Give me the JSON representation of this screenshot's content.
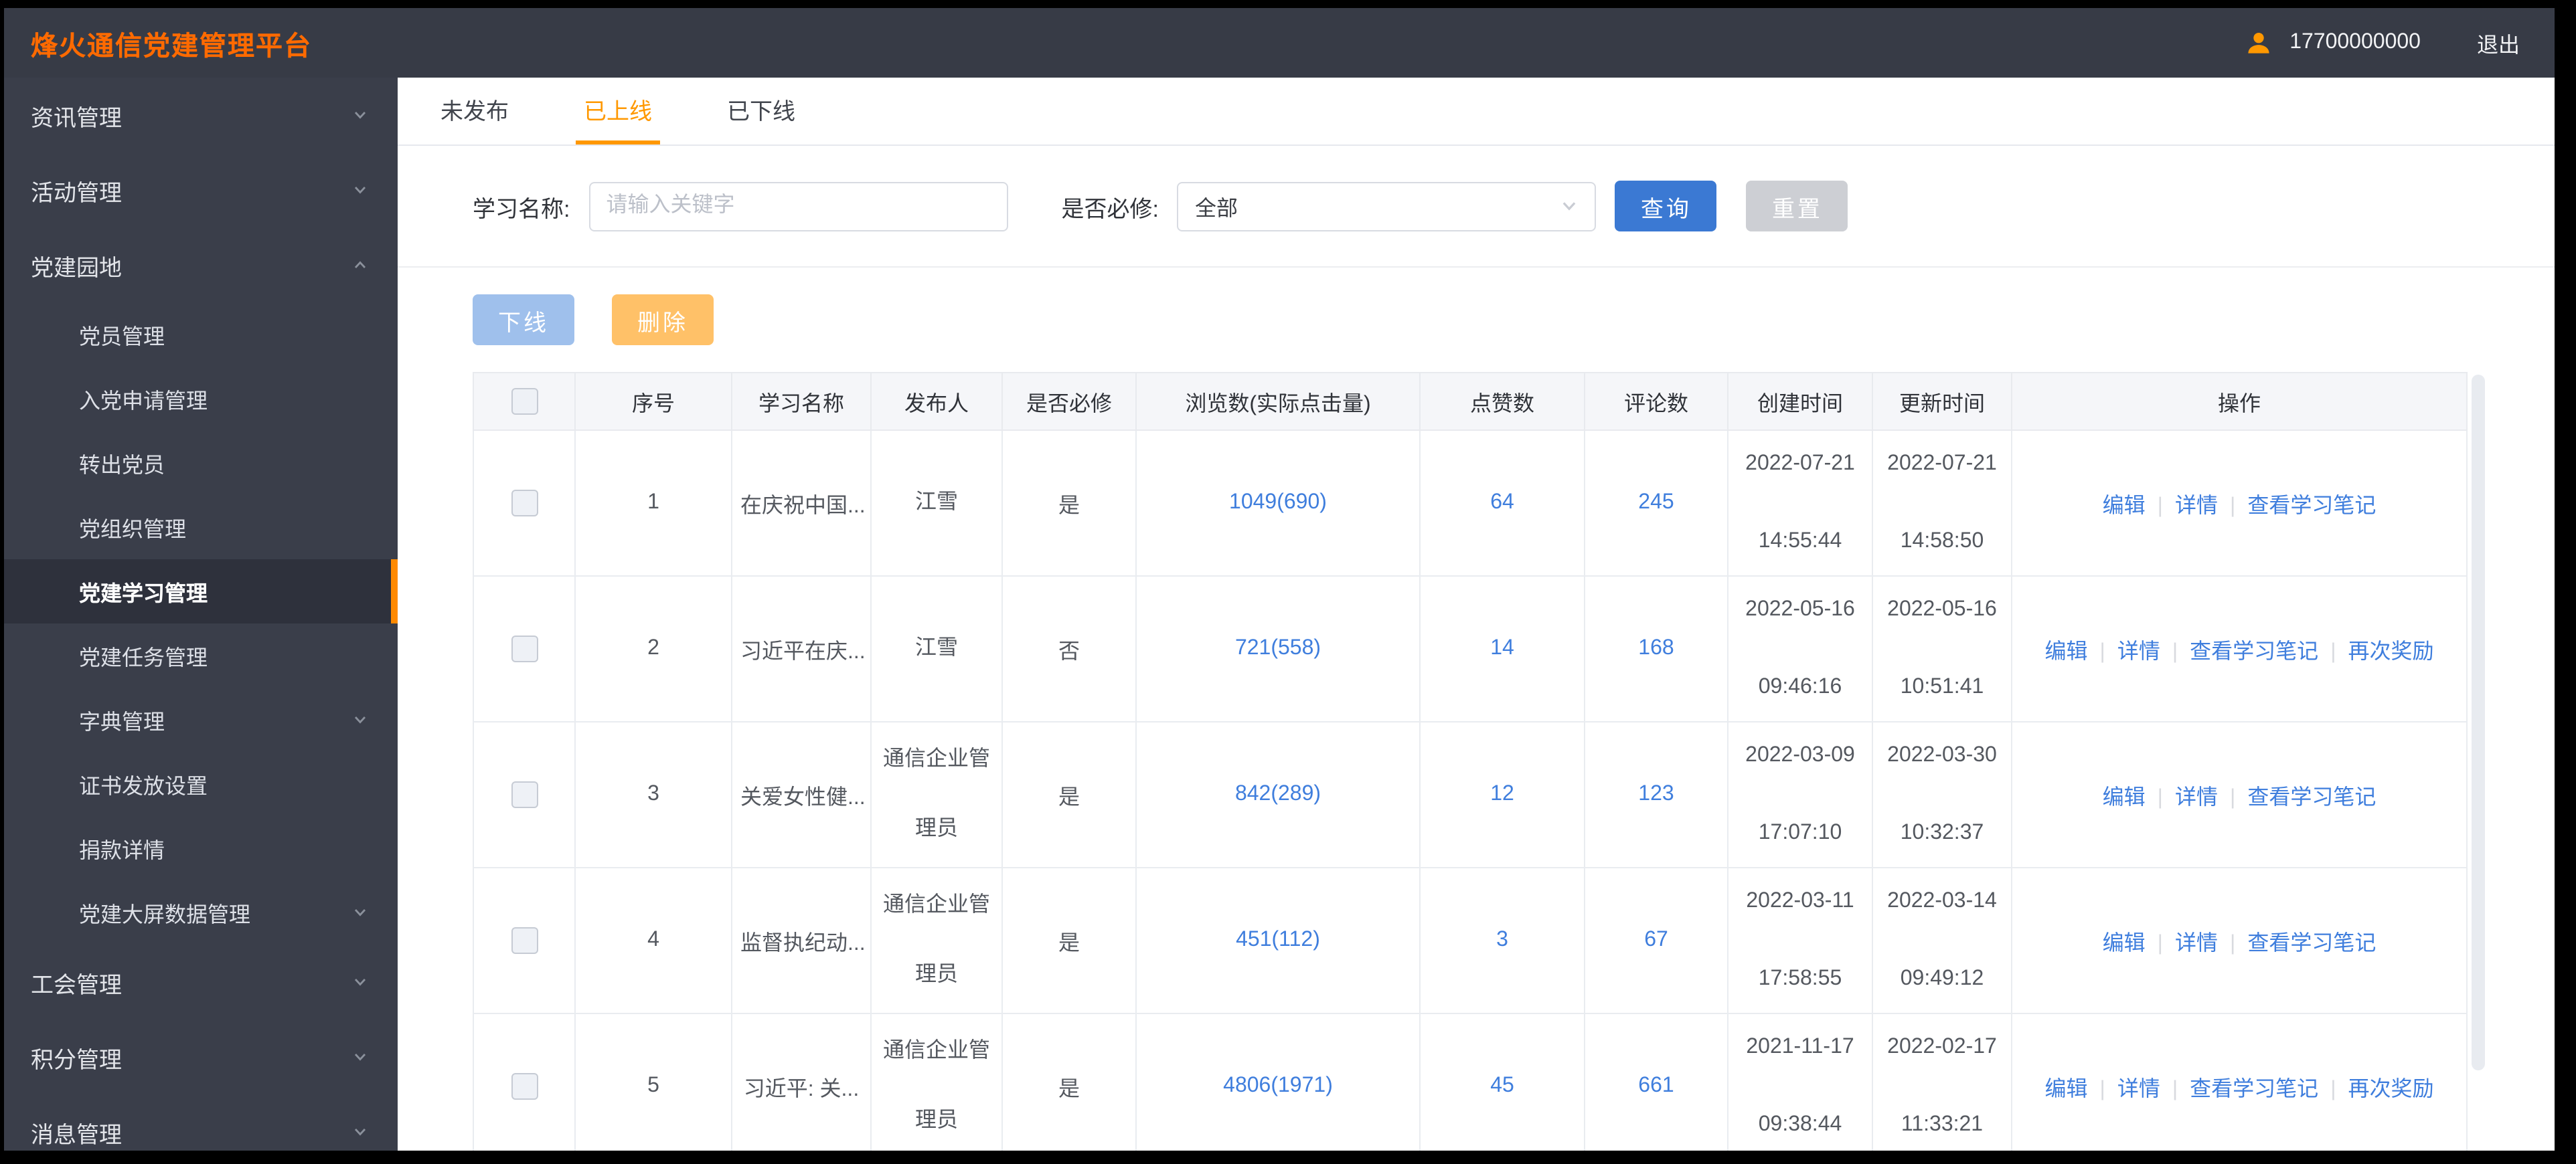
{
  "header": {
    "title": "烽火通信党建管理平台",
    "phone": "17700000000",
    "logout": "退出"
  },
  "sidebar": {
    "items": [
      {
        "label": "资讯管理",
        "type": "group",
        "chevron": "down"
      },
      {
        "label": "活动管理",
        "type": "group",
        "chevron": "down"
      },
      {
        "label": "党建园地",
        "type": "group",
        "chevron": "up",
        "expanded": true
      },
      {
        "label": "党员管理",
        "type": "sub"
      },
      {
        "label": "入党申请管理",
        "type": "sub"
      },
      {
        "label": "转出党员",
        "type": "sub"
      },
      {
        "label": "党组织管理",
        "type": "sub"
      },
      {
        "label": "党建学习管理",
        "type": "sub",
        "active": true
      },
      {
        "label": "党建任务管理",
        "type": "sub"
      },
      {
        "label": "字典管理",
        "type": "sub",
        "chevron": "down"
      },
      {
        "label": "证书发放设置",
        "type": "sub"
      },
      {
        "label": "捐款详情",
        "type": "sub"
      },
      {
        "label": "党建大屏数据管理",
        "type": "sub",
        "chevron": "down"
      },
      {
        "label": "工会管理",
        "type": "group",
        "chevron": "down"
      },
      {
        "label": "积分管理",
        "type": "group",
        "chevron": "down"
      },
      {
        "label": "消息管理",
        "type": "group",
        "chevron": "down"
      }
    ]
  },
  "tabs": [
    {
      "label": "未发布",
      "active": false
    },
    {
      "label": "已上线",
      "active": true
    },
    {
      "label": "已下线",
      "active": false
    }
  ],
  "filters": {
    "name_label": "学习名称:",
    "name_placeholder": "请输入关键字",
    "required_label": "是否必修:",
    "required_value": "全部",
    "search_button": "查询",
    "reset_button": "重置"
  },
  "actions": {
    "offline_button": "下线",
    "delete_button": "删除"
  },
  "table": {
    "headers": [
      "序号",
      "学习名称",
      "发布人",
      "是否必修",
      "浏览数(实际点击量)",
      "点赞数",
      "评论数",
      "创建时间",
      "更新时间",
      "操作"
    ],
    "rows": [
      {
        "no": "1",
        "name": "在庆祝中国...",
        "publisher": "江雪",
        "required": "是",
        "views": "1049(690)",
        "likes": "64",
        "comments": "245",
        "created_date": "2022-07-21",
        "created_time": "14:55:44",
        "updated_date": "2022-07-21",
        "updated_time": "14:58:50",
        "ops": [
          "编辑",
          "详情",
          "查看学习笔记"
        ]
      },
      {
        "no": "2",
        "name": "习近平在庆...",
        "publisher": "江雪",
        "required": "否",
        "views": "721(558)",
        "likes": "14",
        "comments": "168",
        "created_date": "2022-05-16",
        "created_time": "09:46:16",
        "updated_date": "2022-05-16",
        "updated_time": "10:51:41",
        "ops": [
          "编辑",
          "详情",
          "查看学习笔记",
          "再次奖励"
        ]
      },
      {
        "no": "3",
        "name": "关爱女性健...",
        "publisher": "通信企业管理员",
        "required": "是",
        "views": "842(289)",
        "likes": "12",
        "comments": "123",
        "created_date": "2022-03-09",
        "created_time": "17:07:10",
        "updated_date": "2022-03-30",
        "updated_time": "10:32:37",
        "ops": [
          "编辑",
          "详情",
          "查看学习笔记"
        ]
      },
      {
        "no": "4",
        "name": "监督执纪动...",
        "publisher": "通信企业管理员",
        "required": "是",
        "views": "451(112)",
        "likes": "3",
        "comments": "67",
        "created_date": "2022-03-11",
        "created_time": "17:58:55",
        "updated_date": "2022-03-14",
        "updated_time": "09:49:12",
        "ops": [
          "编辑",
          "详情",
          "查看学习笔记"
        ]
      },
      {
        "no": "5",
        "name": "习近平: 关...",
        "publisher": "通信企业管理员",
        "required": "是",
        "views": "4806(1971)",
        "likes": "45",
        "comments": "661",
        "created_date": "2021-11-17",
        "created_time": "09:38:44",
        "updated_date": "2022-02-17",
        "updated_time": "11:33:21",
        "ops": [
          "编辑",
          "详情",
          "查看学习笔记",
          "再次奖励"
        ]
      }
    ]
  },
  "colors": {
    "brand_orange": "#ff6a00",
    "tab_active_orange": "#ff9800",
    "active_item_bar": "#ff8a00",
    "primary_blue": "#3b79d3",
    "link_blue": "#3f7edd",
    "offline_button_blue": "#9fc0ec",
    "delete_button_orange": "#ffc168",
    "reset_button_gray": "#cdcfd4",
    "header_bg": "#373b46",
    "sidebar_bg": "#3a3e4a"
  }
}
